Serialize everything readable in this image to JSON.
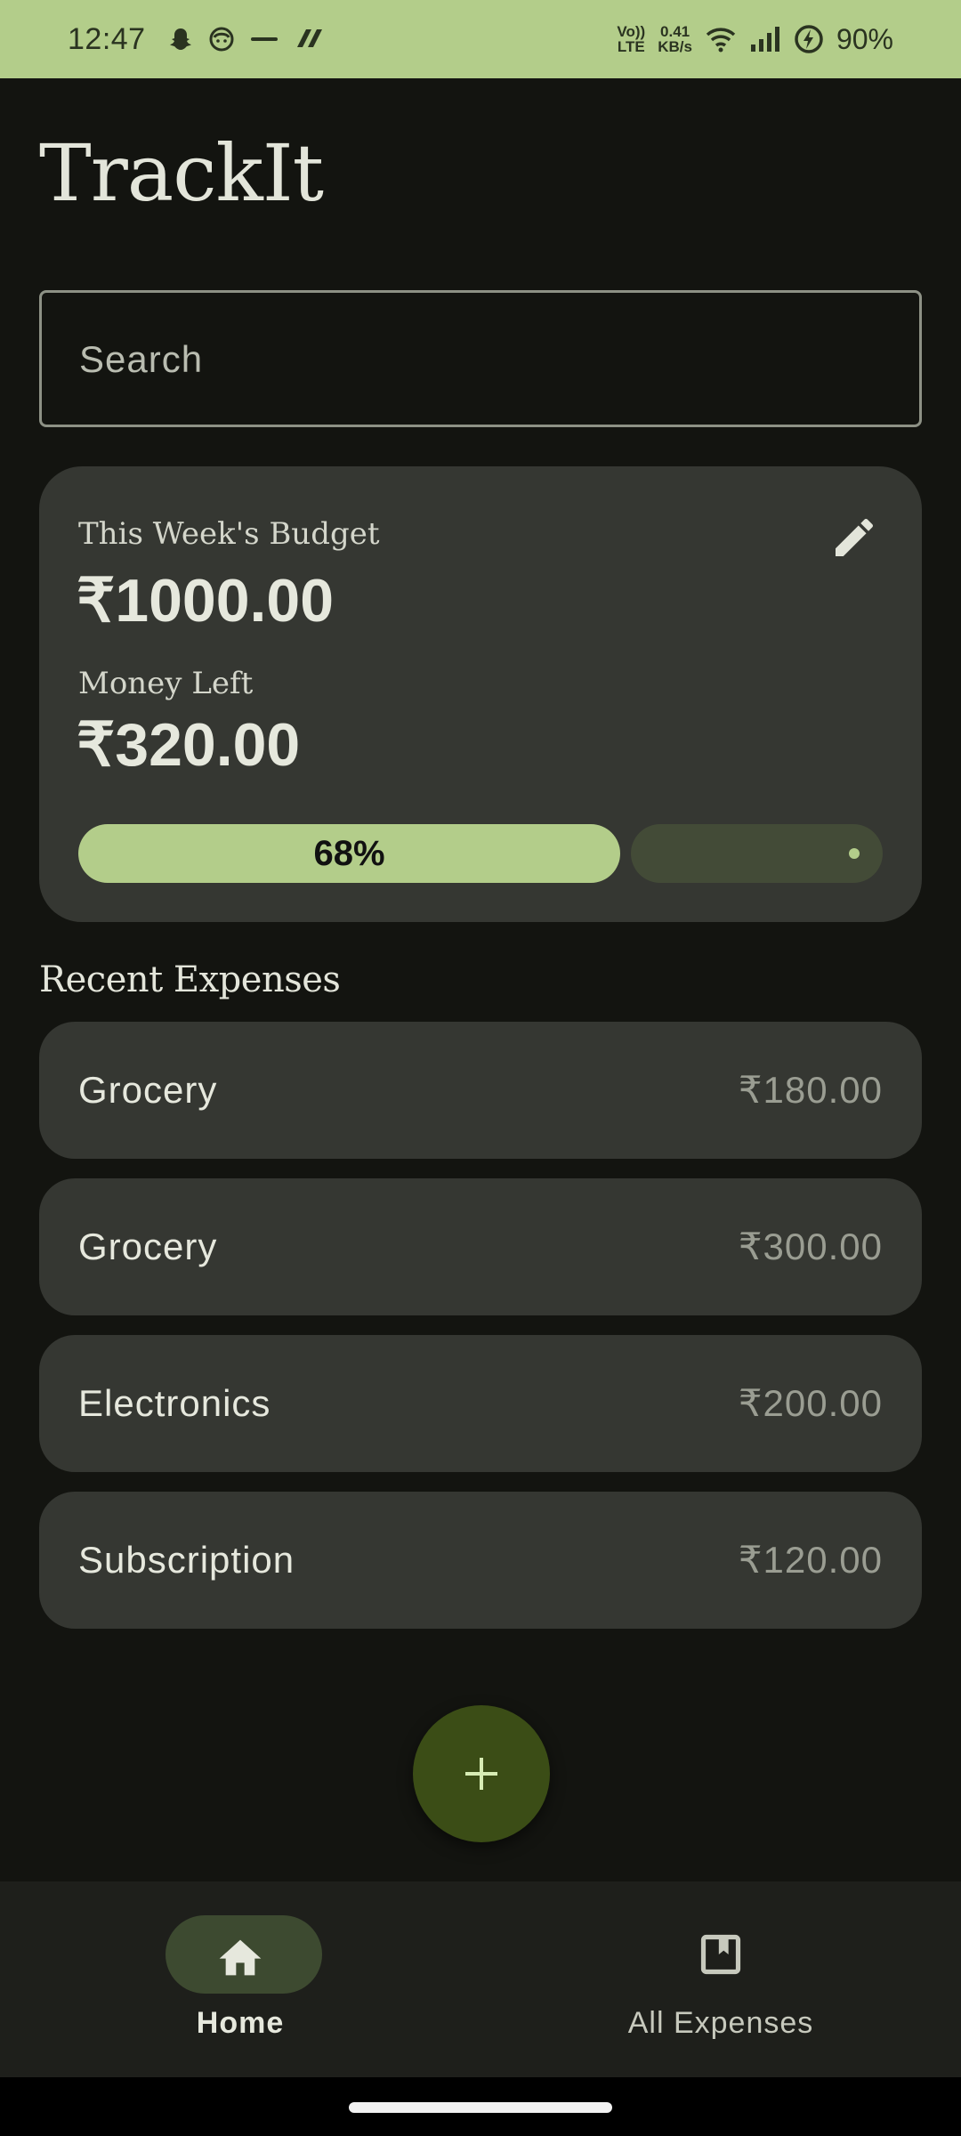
{
  "status_bar": {
    "time": "12:47",
    "icons": [
      "snapchat-icon",
      "face-icon",
      "zomato-icon",
      "app-icon"
    ],
    "network_label_top": "Vo))",
    "network_label_bottom": "LTE",
    "speed_value": "0.41",
    "speed_unit": "KB/s",
    "battery": "90%"
  },
  "app": {
    "title": "TrackIt"
  },
  "search": {
    "placeholder": "Search"
  },
  "budget_card": {
    "budget_label": "This Week's Budget",
    "budget_amount": "₹1000.00",
    "money_left_label": "Money Left",
    "money_left_amount": "₹320.00",
    "progress_text": "68%",
    "progress_fraction": 0.68
  },
  "recent": {
    "title": "Recent Expenses",
    "items": [
      {
        "name": "Grocery",
        "amount": "₹180.00"
      },
      {
        "name": "Grocery",
        "amount": "₹300.00"
      },
      {
        "name": "Electronics",
        "amount": "₹200.00"
      },
      {
        "name": "Subscription",
        "amount": "₹120.00"
      }
    ]
  },
  "bottom_nav": {
    "items": [
      {
        "label": "Home",
        "icon": "home-icon",
        "selected": true
      },
      {
        "label": "All Expenses",
        "icon": "bookmark-icon",
        "selected": false
      }
    ]
  },
  "colors": {
    "accent": "#b3cd8a",
    "background": "#131410",
    "card": "#353732",
    "fab": "#3b4d16"
  }
}
